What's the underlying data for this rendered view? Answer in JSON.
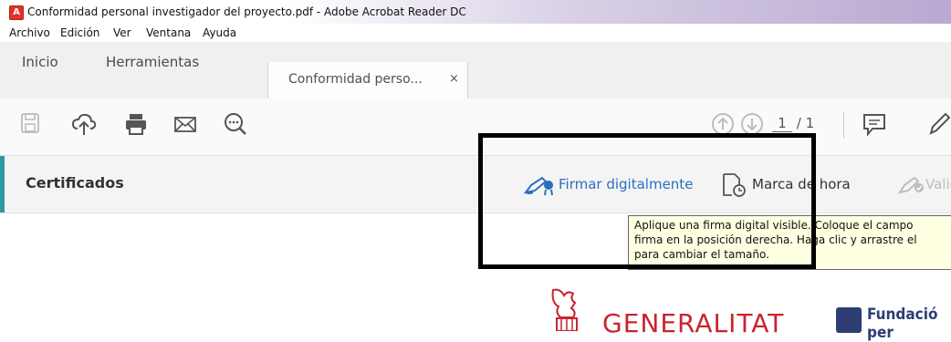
{
  "window": {
    "title": "Conformidad personal investigador del proyecto.pdf - Adobe Acrobat Reader DC"
  },
  "menu": [
    "Archivo",
    "Edición",
    "Ver",
    "Ventana",
    "Ayuda"
  ],
  "tabs": {
    "home": "Inicio",
    "tools": "Herramientas",
    "document": "Conformidad perso...",
    "close_glyph": "×"
  },
  "toolbar": {
    "current_page": "1",
    "page_total": "/ 1"
  },
  "certificados": {
    "title": "Certificados",
    "sign_label": "Firmar digitalmente",
    "timestamp_label": "Marca de hora",
    "validate_label": "Valida"
  },
  "tooltip": {
    "line1": "Aplique una firma digital visible. Coloque el campo",
    "line2": "firma en la posición derecha. Haga clic y arrastre el",
    "line3": "para cambiar el tamaño."
  },
  "document": {
    "logo_text": "GENERALITAT",
    "foundation_text": "Fundació per"
  },
  "colors": {
    "accent_teal": "#2b9aa0",
    "link_blue": "#2a6fbf",
    "tooltip_bg": "#ffffe1",
    "generalitat_red": "#c8242f",
    "foundation_blue": "#2d3e73"
  },
  "icons": {
    "save": "floppy-disk-icon",
    "upload": "cloud-upload-icon",
    "print": "printer-icon",
    "mail": "envelope-icon",
    "search": "zoom-search-icon",
    "page_up": "arrow-up-circle-icon",
    "page_down": "arrow-down-circle-icon",
    "comment": "speech-bubble-icon",
    "pen": "pen-icon",
    "sign": "sign-pen-icon",
    "timestamp": "clock-document-icon",
    "validate": "validate-pen-icon"
  }
}
